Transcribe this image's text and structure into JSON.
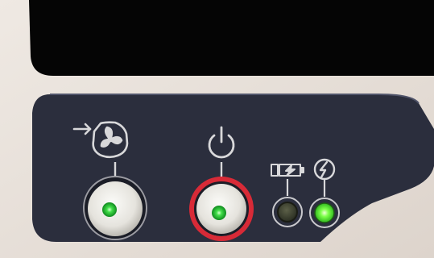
{
  "device": {
    "casing_color": "#e9e2dc",
    "screen_color": "#050505",
    "panel_color": "#2b2e3d",
    "icon_color": "#d8d8da"
  },
  "controls": [
    {
      "id": "ventilation",
      "icon": "fan-arrow-icon",
      "led": "on",
      "led_color": "#27d13a",
      "highlighted": false
    },
    {
      "id": "power",
      "icon": "power-icon",
      "led": "on",
      "led_color": "#27d13a",
      "highlighted": true
    }
  ],
  "indicators": [
    {
      "id": "battery-charging",
      "icon": "battery-charging-icon",
      "led": "off",
      "led_color": "#3a4430"
    },
    {
      "id": "mains-power",
      "icon": "mains-power-icon",
      "led": "on",
      "led_color": "#5cff3a"
    }
  ],
  "highlight_color": "#d82a37"
}
